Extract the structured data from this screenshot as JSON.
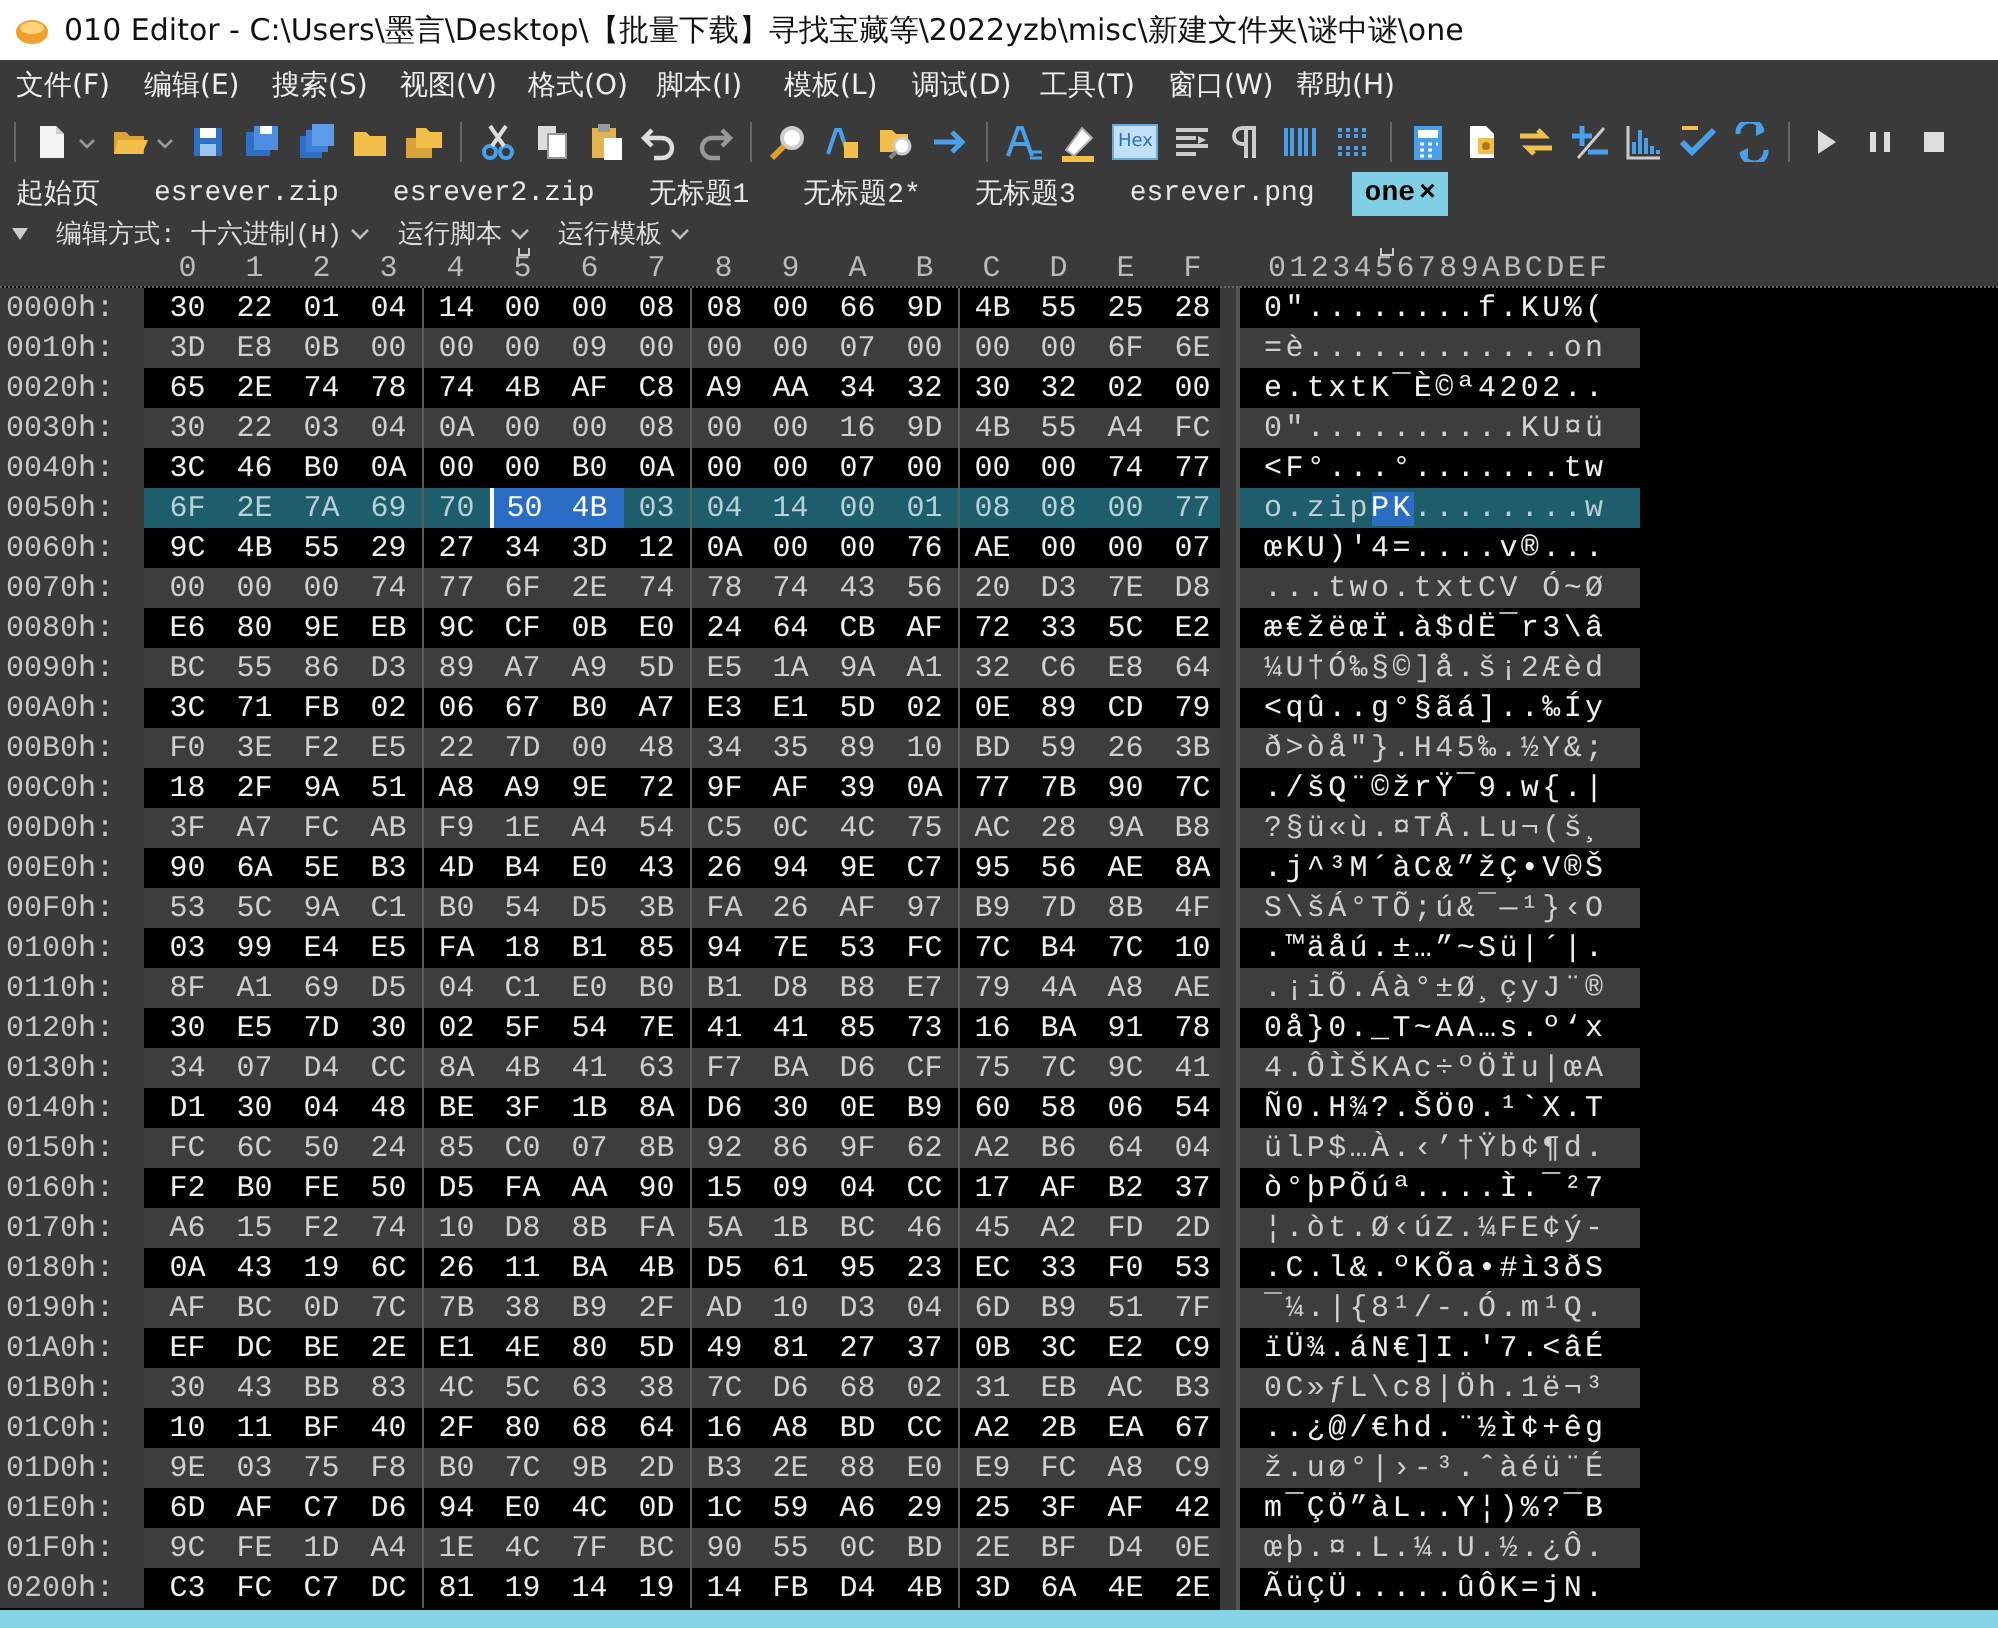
{
  "window": {
    "title": "010 Editor - C:\\Users\\墨言\\Desktop\\【批量下载】寻找宝藏等\\2022yzb\\misc\\新建文件夹\\谜中谜\\one"
  },
  "menu": [
    "文件(F)",
    "编辑(E)",
    "搜索(S)",
    "视图(V)",
    "格式(O)",
    "脚本(I)",
    "模板(L)",
    "调试(D)",
    "工具(T)",
    "窗口(W)",
    "帮助(H)"
  ],
  "hex_toggle": {
    "label": "Hex",
    "on": true
  },
  "tabs": [
    {
      "label": "起始页",
      "selected": false
    },
    {
      "label": "esrever.zip",
      "selected": false
    },
    {
      "label": "esrever2.zip",
      "selected": false
    },
    {
      "label": "无标题1",
      "selected": false
    },
    {
      "label": "无标题2*",
      "selected": false
    },
    {
      "label": "无标题3",
      "selected": false
    },
    {
      "label": "esrever.png",
      "selected": false
    },
    {
      "label": "one",
      "selected": true,
      "close": "×"
    }
  ],
  "subbar": [
    "编辑方式: 十六进制(H)",
    "运行脚本",
    "运行模板"
  ],
  "hex_columns": [
    {
      "label": "0",
      "selected": false
    },
    {
      "label": "1",
      "selected": false
    },
    {
      "label": "2",
      "selected": false
    },
    {
      "label": "3",
      "selected": false
    },
    {
      "label": "4",
      "selected": false
    },
    {
      "label": "5",
      "selected": true
    },
    {
      "label": "6",
      "selected": false
    },
    {
      "label": "7",
      "selected": false
    },
    {
      "label": "8",
      "selected": false
    },
    {
      "label": "9",
      "selected": false
    },
    {
      "label": "A",
      "selected": false
    },
    {
      "label": "B",
      "selected": false
    },
    {
      "label": "C",
      "selected": false
    },
    {
      "label": "D",
      "selected": false
    },
    {
      "label": "E",
      "selected": false
    },
    {
      "label": "F",
      "selected": false
    }
  ],
  "ascii_header": "0123456789ABCDEF",
  "rows": [
    {
      "offset": "0000h:",
      "current": false,
      "hex": [
        {
          "bytes": [
            "30",
            "22",
            "01",
            "04",
            "14",
            "00",
            "00",
            "08",
            "08",
            "00",
            "66",
            "9D",
            "4B",
            "55",
            "25",
            "28"
          ],
          "selected": false
        }
      ],
      "ascii": [
        {
          "text": "0\"........f.KU%(",
          "selected": false
        }
      ]
    },
    {
      "offset": "0010h:",
      "current": false,
      "hex": [
        {
          "bytes": [
            "3D",
            "E8",
            "0B",
            "00",
            "00",
            "00",
            "09",
            "00",
            "00",
            "00",
            "07",
            "00",
            "00",
            "00",
            "6F",
            "6E"
          ],
          "selected": false
        }
      ],
      "ascii": [
        {
          "text": "=è............on",
          "selected": false
        }
      ]
    },
    {
      "offset": "0020h:",
      "current": false,
      "hex": [
        {
          "bytes": [
            "65",
            "2E",
            "74",
            "78",
            "74",
            "4B",
            "AF",
            "C8",
            "A9",
            "AA",
            "34",
            "32",
            "30",
            "32",
            "02",
            "00"
          ],
          "selected": false
        }
      ],
      "ascii": [
        {
          "text": "e.txtK¯È©ª4202..",
          "selected": false
        }
      ]
    },
    {
      "offset": "0030h:",
      "current": false,
      "hex": [
        {
          "bytes": [
            "30",
            "22",
            "03",
            "04",
            "0A",
            "00",
            "00",
            "08",
            "00",
            "00",
            "16",
            "9D",
            "4B",
            "55",
            "A4",
            "FC"
          ],
          "selected": false
        }
      ],
      "ascii": [
        {
          "text": "0\"..........KU¤ü",
          "selected": false
        }
      ]
    },
    {
      "offset": "0040h:",
      "current": false,
      "hex": [
        {
          "bytes": [
            "3C",
            "46",
            "B0",
            "0A",
            "00",
            "00",
            "B0",
            "0A",
            "00",
            "00",
            "07",
            "00",
            "00",
            "00",
            "74",
            "77"
          ],
          "selected": false
        }
      ],
      "ascii": [
        {
          "text": "<F°...°.......tw",
          "selected": false
        }
      ]
    },
    {
      "offset": "0050h:",
      "current": true,
      "hex": [
        {
          "bytes": [
            "6F",
            "2E",
            "7A",
            "69",
            "70"
          ],
          "selected": false
        },
        {
          "bytes": [
            "50",
            "4B"
          ],
          "selected": true
        },
        {
          "bytes": [
            "03",
            "04",
            "14",
            "00",
            "01",
            "08",
            "08",
            "00",
            "77"
          ],
          "selected": false
        }
      ],
      "ascii": [
        {
          "text": "o.zip",
          "selected": false
        },
        {
          "text": "PK",
          "selected": true
        },
        {
          "text": "........w",
          "selected": false
        }
      ]
    },
    {
      "offset": "0060h:",
      "current": false,
      "hex": [
        {
          "bytes": [
            "9C",
            "4B",
            "55",
            "29",
            "27",
            "34",
            "3D",
            "12",
            "0A",
            "00",
            "00",
            "76",
            "AE",
            "00",
            "00",
            "07"
          ],
          "selected": false
        }
      ],
      "ascii": [
        {
          "text": "œKU)'4=....v®...",
          "selected": false
        }
      ]
    },
    {
      "offset": "0070h:",
      "current": false,
      "hex": [
        {
          "bytes": [
            "00",
            "00",
            "00",
            "74",
            "77",
            "6F",
            "2E",
            "74",
            "78",
            "74",
            "43",
            "56",
            "20",
            "D3",
            "7E",
            "D8"
          ],
          "selected": false
        }
      ],
      "ascii": [
        {
          "text": "...two.txtCV Ó~Ø",
          "selected": false
        }
      ]
    },
    {
      "offset": "0080h:",
      "current": false,
      "hex": [
        {
          "bytes": [
            "E6",
            "80",
            "9E",
            "EB",
            "9C",
            "CF",
            "0B",
            "E0",
            "24",
            "64",
            "CB",
            "AF",
            "72",
            "33",
            "5C",
            "E2"
          ],
          "selected": false
        }
      ],
      "ascii": [
        {
          "text": "æ€žëœÏ.à$dË¯r3\\â",
          "selected": false
        }
      ]
    },
    {
      "offset": "0090h:",
      "current": false,
      "hex": [
        {
          "bytes": [
            "BC",
            "55",
            "86",
            "D3",
            "89",
            "A7",
            "A9",
            "5D",
            "E5",
            "1A",
            "9A",
            "A1",
            "32",
            "C6",
            "E8",
            "64"
          ],
          "selected": false
        }
      ],
      "ascii": [
        {
          "text": "¼U†Ó‰§©]å.š¡2Æèd",
          "selected": false
        }
      ]
    },
    {
      "offset": "00A0h:",
      "current": false,
      "hex": [
        {
          "bytes": [
            "3C",
            "71",
            "FB",
            "02",
            "06",
            "67",
            "B0",
            "A7",
            "E3",
            "E1",
            "5D",
            "02",
            "0E",
            "89",
            "CD",
            "79"
          ],
          "selected": false
        }
      ],
      "ascii": [
        {
          "text": "<qû..g°§ãá]..‰Íy",
          "selected": false
        }
      ]
    },
    {
      "offset": "00B0h:",
      "current": false,
      "hex": [
        {
          "bytes": [
            "F0",
            "3E",
            "F2",
            "E5",
            "22",
            "7D",
            "00",
            "48",
            "34",
            "35",
            "89",
            "10",
            "BD",
            "59",
            "26",
            "3B"
          ],
          "selected": false
        }
      ],
      "ascii": [
        {
          "text": "ð>òå\"}.H45‰.½Y&;",
          "selected": false
        }
      ]
    },
    {
      "offset": "00C0h:",
      "current": false,
      "hex": [
        {
          "bytes": [
            "18",
            "2F",
            "9A",
            "51",
            "A8",
            "A9",
            "9E",
            "72",
            "9F",
            "AF",
            "39",
            "0A",
            "77",
            "7B",
            "90",
            "7C"
          ],
          "selected": false
        }
      ],
      "ascii": [
        {
          "text": "./šQ¨©žrŸ¯9.w{.|",
          "selected": false
        }
      ]
    },
    {
      "offset": "00D0h:",
      "current": false,
      "hex": [
        {
          "bytes": [
            "3F",
            "A7",
            "FC",
            "AB",
            "F9",
            "1E",
            "A4",
            "54",
            "C5",
            "0C",
            "4C",
            "75",
            "AC",
            "28",
            "9A",
            "B8"
          ],
          "selected": false
        }
      ],
      "ascii": [
        {
          "text": "?§ü«ù.¤TÅ.Lu¬(š¸",
          "selected": false
        }
      ]
    },
    {
      "offset": "00E0h:",
      "current": false,
      "hex": [
        {
          "bytes": [
            "90",
            "6A",
            "5E",
            "B3",
            "4D",
            "B4",
            "E0",
            "43",
            "26",
            "94",
            "9E",
            "C7",
            "95",
            "56",
            "AE",
            "8A"
          ],
          "selected": false
        }
      ],
      "ascii": [
        {
          "text": ".j^³M´àC&”žÇ•V®Š",
          "selected": false
        }
      ]
    },
    {
      "offset": "00F0h:",
      "current": false,
      "hex": [
        {
          "bytes": [
            "53",
            "5C",
            "9A",
            "C1",
            "B0",
            "54",
            "D5",
            "3B",
            "FA",
            "26",
            "AF",
            "97",
            "B9",
            "7D",
            "8B",
            "4F"
          ],
          "selected": false
        }
      ],
      "ascii": [
        {
          "text": "S\\šÁ°TÕ;ú&¯—¹}‹O",
          "selected": false
        }
      ]
    },
    {
      "offset": "0100h:",
      "current": false,
      "hex": [
        {
          "bytes": [
            "03",
            "99",
            "E4",
            "E5",
            "FA",
            "18",
            "B1",
            "85",
            "94",
            "7E",
            "53",
            "FC",
            "7C",
            "B4",
            "7C",
            "10"
          ],
          "selected": false
        }
      ],
      "ascii": [
        {
          "text": ".™äåú.±…”~Sü|´|.",
          "selected": false
        }
      ]
    },
    {
      "offset": "0110h:",
      "current": false,
      "hex": [
        {
          "bytes": [
            "8F",
            "A1",
            "69",
            "D5",
            "04",
            "C1",
            "E0",
            "B0",
            "B1",
            "D8",
            "B8",
            "E7",
            "79",
            "4A",
            "A8",
            "AE"
          ],
          "selected": false
        }
      ],
      "ascii": [
        {
          "text": ".¡iÕ.Áà°±Ø¸çyJ¨®",
          "selected": false
        }
      ]
    },
    {
      "offset": "0120h:",
      "current": false,
      "hex": [
        {
          "bytes": [
            "30",
            "E5",
            "7D",
            "30",
            "02",
            "5F",
            "54",
            "7E",
            "41",
            "41",
            "85",
            "73",
            "16",
            "BA",
            "91",
            "78"
          ],
          "selected": false
        }
      ],
      "ascii": [
        {
          "text": "0å}0._T~AA…s.º‘x",
          "selected": false
        }
      ]
    },
    {
      "offset": "0130h:",
      "current": false,
      "hex": [
        {
          "bytes": [
            "34",
            "07",
            "D4",
            "CC",
            "8A",
            "4B",
            "41",
            "63",
            "F7",
            "BA",
            "D6",
            "CF",
            "75",
            "7C",
            "9C",
            "41"
          ],
          "selected": false
        }
      ],
      "ascii": [
        {
          "text": "4.ÔÌŠKAc÷ºÖÏu|œA",
          "selected": false
        }
      ]
    },
    {
      "offset": "0140h:",
      "current": false,
      "hex": [
        {
          "bytes": [
            "D1",
            "30",
            "04",
            "48",
            "BE",
            "3F",
            "1B",
            "8A",
            "D6",
            "30",
            "0E",
            "B9",
            "60",
            "58",
            "06",
            "54"
          ],
          "selected": false
        }
      ],
      "ascii": [
        {
          "text": "Ñ0.H¾?.ŠÖ0.¹`X.T",
          "selected": false
        }
      ]
    },
    {
      "offset": "0150h:",
      "current": false,
      "hex": [
        {
          "bytes": [
            "FC",
            "6C",
            "50",
            "24",
            "85",
            "C0",
            "07",
            "8B",
            "92",
            "86",
            "9F",
            "62",
            "A2",
            "B6",
            "64",
            "04"
          ],
          "selected": false
        }
      ],
      "ascii": [
        {
          "text": "ülP$…À.‹’†Ÿb¢¶d.",
          "selected": false
        }
      ]
    },
    {
      "offset": "0160h:",
      "current": false,
      "hex": [
        {
          "bytes": [
            "F2",
            "B0",
            "FE",
            "50",
            "D5",
            "FA",
            "AA",
            "90",
            "15",
            "09",
            "04",
            "CC",
            "17",
            "AF",
            "B2",
            "37"
          ],
          "selected": false
        }
      ],
      "ascii": [
        {
          "text": "ò°þPÕúª....Ì.¯²7",
          "selected": false
        }
      ]
    },
    {
      "offset": "0170h:",
      "current": false,
      "hex": [
        {
          "bytes": [
            "A6",
            "15",
            "F2",
            "74",
            "10",
            "D8",
            "8B",
            "FA",
            "5A",
            "1B",
            "BC",
            "46",
            "45",
            "A2",
            "FD",
            "2D"
          ],
          "selected": false
        }
      ],
      "ascii": [
        {
          "text": "¦.òt.Ø‹úZ.¼FE¢ý-",
          "selected": false
        }
      ]
    },
    {
      "offset": "0180h:",
      "current": false,
      "hex": [
        {
          "bytes": [
            "0A",
            "43",
            "19",
            "6C",
            "26",
            "11",
            "BA",
            "4B",
            "D5",
            "61",
            "95",
            "23",
            "EC",
            "33",
            "F0",
            "53"
          ],
          "selected": false
        }
      ],
      "ascii": [
        {
          "text": ".C.l&.ºKÕa•#ì3ðS",
          "selected": false
        }
      ]
    },
    {
      "offset": "0190h:",
      "current": false,
      "hex": [
        {
          "bytes": [
            "AF",
            "BC",
            "0D",
            "7C",
            "7B",
            "38",
            "B9",
            "2F",
            "AD",
            "10",
            "D3",
            "04",
            "6D",
            "B9",
            "51",
            "7F"
          ],
          "selected": false
        }
      ],
      "ascii": [
        {
          "text": "¯¼.|{8¹/-.Ó.m¹Q.",
          "selected": false
        }
      ]
    },
    {
      "offset": "01A0h:",
      "current": false,
      "hex": [
        {
          "bytes": [
            "EF",
            "DC",
            "BE",
            "2E",
            "E1",
            "4E",
            "80",
            "5D",
            "49",
            "81",
            "27",
            "37",
            "0B",
            "3C",
            "E2",
            "C9"
          ],
          "selected": false
        }
      ],
      "ascii": [
        {
          "text": "ïÜ¾.áN€]I.'7.<âÉ",
          "selected": false
        }
      ]
    },
    {
      "offset": "01B0h:",
      "current": false,
      "hex": [
        {
          "bytes": [
            "30",
            "43",
            "BB",
            "83",
            "4C",
            "5C",
            "63",
            "38",
            "7C",
            "D6",
            "68",
            "02",
            "31",
            "EB",
            "AC",
            "B3"
          ],
          "selected": false
        }
      ],
      "ascii": [
        {
          "text": "0C»ƒL\\c8|Öh.1ë¬³",
          "selected": false
        }
      ]
    },
    {
      "offset": "01C0h:",
      "current": false,
      "hex": [
        {
          "bytes": [
            "10",
            "11",
            "BF",
            "40",
            "2F",
            "80",
            "68",
            "64",
            "16",
            "A8",
            "BD",
            "CC",
            "A2",
            "2B",
            "EA",
            "67"
          ],
          "selected": false
        }
      ],
      "ascii": [
        {
          "text": "..¿@/€hd.¨½Ì¢+êg",
          "selected": false
        }
      ]
    },
    {
      "offset": "01D0h:",
      "current": false,
      "hex": [
        {
          "bytes": [
            "9E",
            "03",
            "75",
            "F8",
            "B0",
            "7C",
            "9B",
            "2D",
            "B3",
            "2E",
            "88",
            "E0",
            "E9",
            "FC",
            "A8",
            "C9"
          ],
          "selected": false
        }
      ],
      "ascii": [
        {
          "text": "ž.uø°|›-³.ˆàéü¨É",
          "selected": false
        }
      ]
    },
    {
      "offset": "01E0h:",
      "current": false,
      "hex": [
        {
          "bytes": [
            "6D",
            "AF",
            "C7",
            "D6",
            "94",
            "E0",
            "4C",
            "0D",
            "1C",
            "59",
            "A6",
            "29",
            "25",
            "3F",
            "AF",
            "42"
          ],
          "selected": false
        }
      ],
      "ascii": [
        {
          "text": "m¯ÇÖ”àL..Y¦)%?¯B",
          "selected": false
        }
      ]
    },
    {
      "offset": "01F0h:",
      "current": false,
      "hex": [
        {
          "bytes": [
            "9C",
            "FE",
            "1D",
            "A4",
            "1E",
            "4C",
            "7F",
            "BC",
            "90",
            "55",
            "0C",
            "BD",
            "2E",
            "BF",
            "D4",
            "0E"
          ],
          "selected": false
        }
      ],
      "ascii": [
        {
          "text": "œþ.¤.L.¼.U.½.¿Ô.",
          "selected": false
        }
      ]
    },
    {
      "offset": "0200h:",
      "current": false,
      "hex": [
        {
          "bytes": [
            "C3",
            "FC",
            "C7",
            "DC",
            "81",
            "19",
            "14",
            "19",
            "14",
            "FB",
            "D4",
            "4B",
            "3D",
            "6A",
            "4E",
            "2E"
          ],
          "selected": false
        }
      ],
      "ascii": [
        {
          "text": "ÃüÇÜ.....ûÔK=jN.",
          "selected": false
        }
      ]
    }
  ]
}
